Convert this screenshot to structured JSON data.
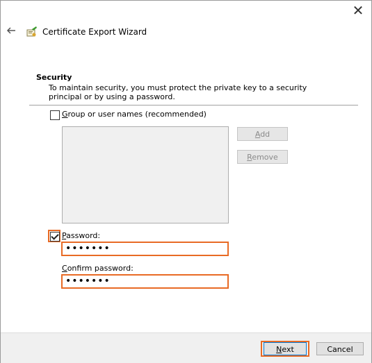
{
  "window": {
    "close_glyph": "✕",
    "title": "Certificate Export Wizard",
    "back_icon": "back-arrow-icon",
    "app_icon": "certificate-icon"
  },
  "section": {
    "title": "Security",
    "description": "To maintain security, you must protect the private key to a security principal or by using a password."
  },
  "group_option": {
    "label_prefix": "",
    "label_underlined": "G",
    "label_rest": "roup or user names (recommended)",
    "checked": false
  },
  "principal_buttons": {
    "add": {
      "underlined": "A",
      "rest": "dd",
      "enabled": false
    },
    "remove": {
      "underlined": "R",
      "rest": "emove",
      "enabled": false
    }
  },
  "password": {
    "checkbox_checked": true,
    "label_underlined": "P",
    "label_rest": "assword:",
    "value_masked": "•••••••",
    "confirm_label_underlined": "C",
    "confirm_label_rest": "onfirm password:",
    "confirm_value_masked": "•••••••"
  },
  "footer": {
    "next": {
      "underlined": "N",
      "rest": "ext"
    },
    "cancel": "Cancel"
  },
  "colors": {
    "highlight": "#e86a24",
    "footer_bg": "#f0f0f0"
  }
}
